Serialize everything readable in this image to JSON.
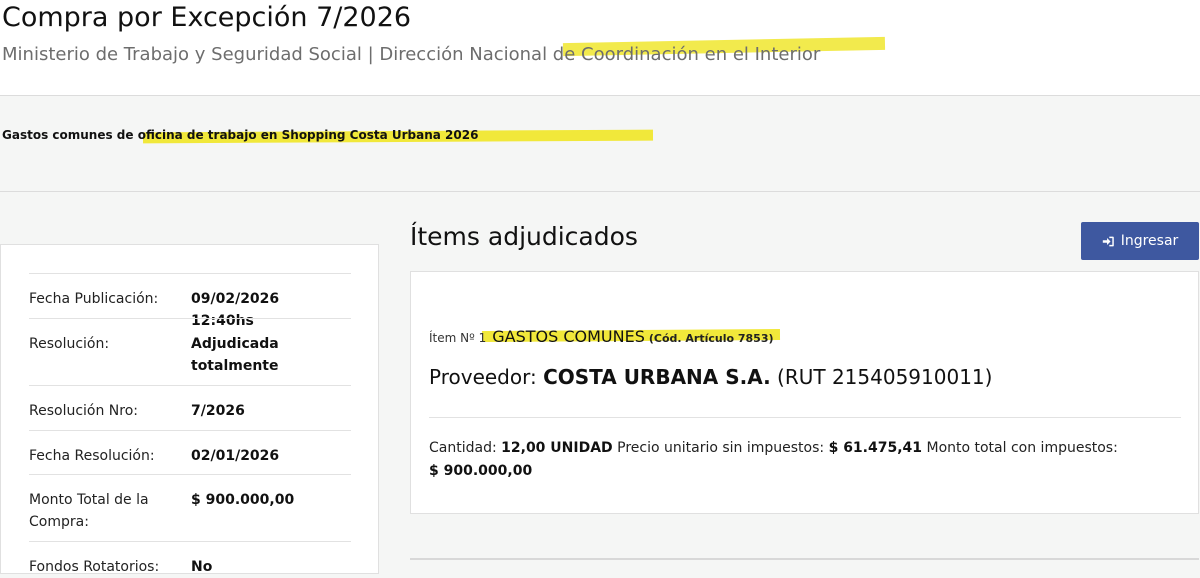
{
  "header": {
    "title": "Compra por Excepción 7/2026",
    "subtitle": "Ministerio de Trabajo y Seguridad Social | Dirección Nacional de Coordinación en el Interior"
  },
  "description": "Gastos comunes de oficina de trabajo en Shopping Costa Urbana 2026",
  "details": [
    {
      "label": "Fecha Publicación:",
      "value": "09/02/2026 12:40hs"
    },
    {
      "label": "Resolución:",
      "value": "Adjudicada totalmente"
    },
    {
      "label": "Resolución Nro:",
      "value": "7/2026"
    },
    {
      "label": "Fecha Resolución:",
      "value": "02/01/2026"
    },
    {
      "label": "Monto Total de la Compra:",
      "value": "$ 900.000,00"
    },
    {
      "label": "Fondos Rotatorios:",
      "value": "No"
    }
  ],
  "items_section": {
    "title": "Ítems adjudicados",
    "login_label": "Ingresar",
    "login_icon": "sign-in-icon"
  },
  "item": {
    "number_label": "Ítem Nº 1",
    "name": "GASTOS COMUNES",
    "code": "(Cód. Artículo 7853)",
    "provider_prefix": "Proveedor:",
    "provider_name": "COSTA URBANA S.A.",
    "provider_rut": "(RUT 215405910011)",
    "quantity_label": "Cantidad:",
    "quantity_value": "12,00 UNIDAD",
    "unit_price_label": "Precio unitario sin impuestos:",
    "unit_price_value": "$ 61.475,41",
    "total_label": "Monto total con impuestos:",
    "total_value": "$ 900.000,00"
  },
  "colors": {
    "highlight": "#f1e83a",
    "button": "#3e58a0"
  }
}
